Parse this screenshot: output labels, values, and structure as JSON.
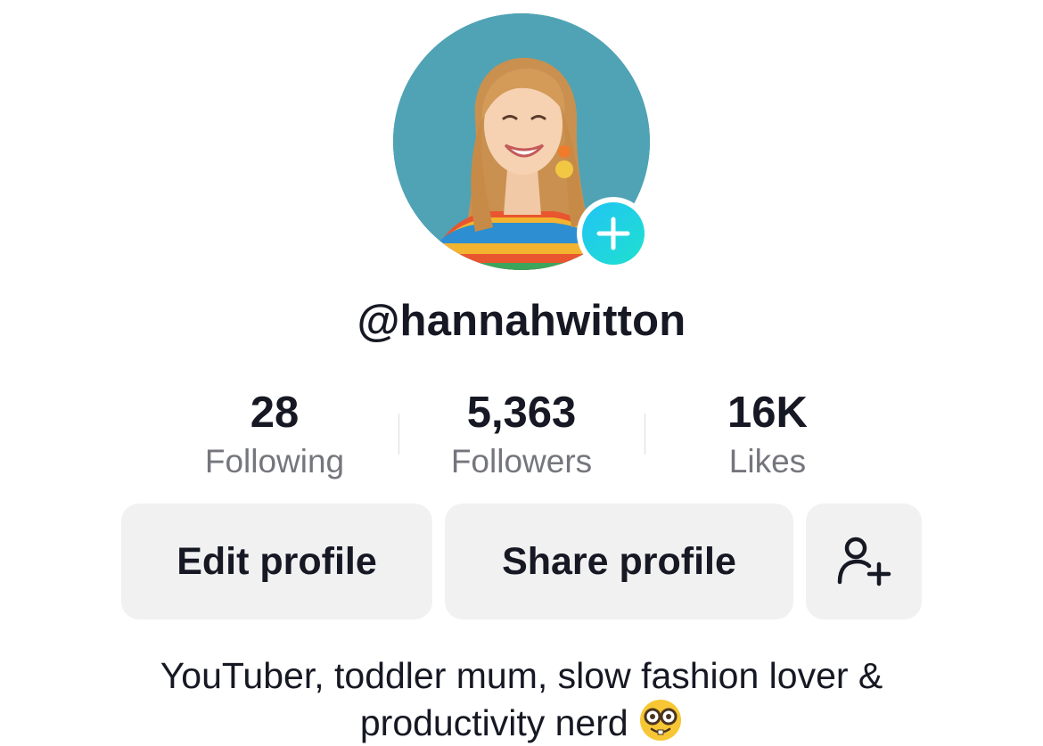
{
  "profile": {
    "username": "@hannahwitton",
    "bio_text": "YouTuber, toddler mum, slow fashion lover & productivity nerd",
    "bio_emoji": "nerd-face-emoji"
  },
  "stats": [
    {
      "value": "28",
      "label": "Following"
    },
    {
      "value": "5,363",
      "label": "Followers"
    },
    {
      "value": "16K",
      "label": "Likes"
    }
  ],
  "buttons": {
    "edit_label": "Edit profile",
    "share_label": "Share profile",
    "add_friend_icon": "person-add-icon"
  },
  "colors": {
    "primary_text": "#161823",
    "secondary_text": "#75767d",
    "button_bg": "#f1f1f2",
    "badge_gradient_start": "#20c4f4",
    "badge_gradient_end": "#1fe0cf",
    "avatar_bg": "#4fa3b5"
  }
}
